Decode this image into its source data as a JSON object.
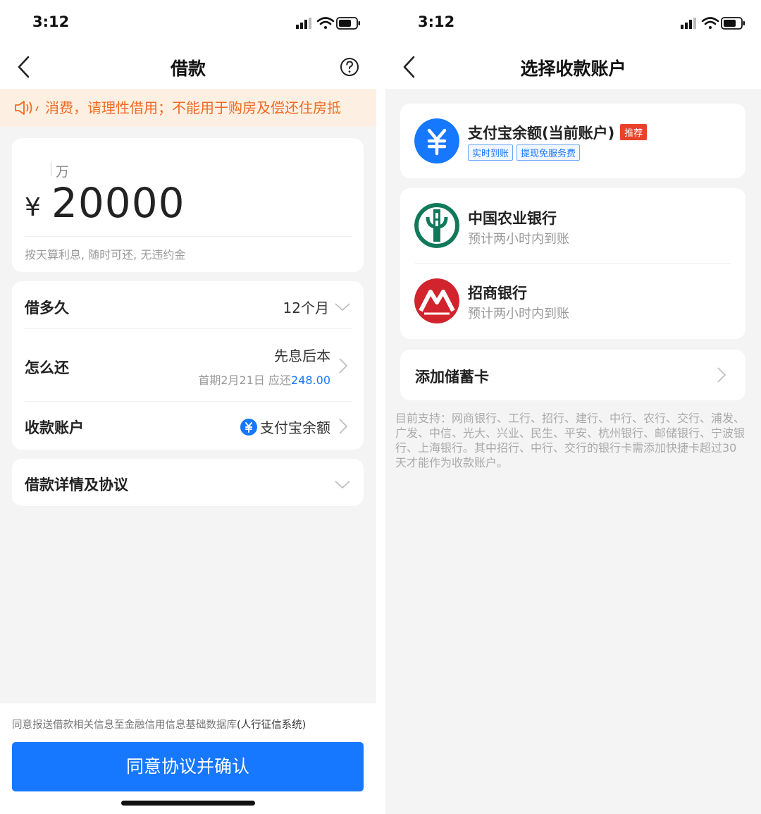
{
  "left": {
    "status": {
      "time": "3:12"
    },
    "nav": {
      "title": "借款"
    },
    "notice": {
      "text": "消费，请理性借用；不能用于购房及偿还住房抵"
    },
    "amount": {
      "unit_hint": "万",
      "currency": "¥",
      "value": "20000",
      "note": "按天算利息, 随时可还, 无违约金"
    },
    "terms": {
      "duration_label": "借多久",
      "duration_value": "12个月",
      "repay_label": "怎么还",
      "repay_value": "先息后本",
      "repay_first_prefix": "首期2月21日 应还",
      "repay_first_amount": "248.00",
      "account_label": "收款账户",
      "account_value": "支付宝余额"
    },
    "details": {
      "label": "借款详情及协议"
    },
    "bottom": {
      "consent_prefix": "同意报送借款相关信息至金融信用信息基础数据库",
      "consent_bold": "(人行征信系统)",
      "button_label": "同意协议并确认"
    }
  },
  "right": {
    "status": {
      "time": "3:12"
    },
    "nav": {
      "title": "选择收款账户"
    },
    "alipay": {
      "name": "支付宝余额(当前账户)",
      "badge": "推荐",
      "tags": [
        "实时到账",
        "提现免服务费"
      ]
    },
    "banks": [
      {
        "name": "中国农业银行",
        "sub": "预计两小时内到账",
        "icon": "abc-bank-logo"
      },
      {
        "name": "招商银行",
        "sub": "预计两小时内到账",
        "icon": "cmb-bank-logo"
      }
    ],
    "add_card": {
      "label": "添加储蓄卡"
    },
    "support_text": "目前支持：网商银行、工行、招行、建行、中行、农行、交行、浦发、广发、中信、光大、兴业、民生、平安、杭州银行、邮储银行、宁波银行、上海银行。其中招行、中行、交行的银行卡需添加快捷卡超过30天才能作为收款账户。"
  },
  "colors": {
    "accent": "#1677ff",
    "notice_text": "#ee6a22",
    "notice_bg": "#fdf0e2",
    "badge": "#e8432a"
  }
}
